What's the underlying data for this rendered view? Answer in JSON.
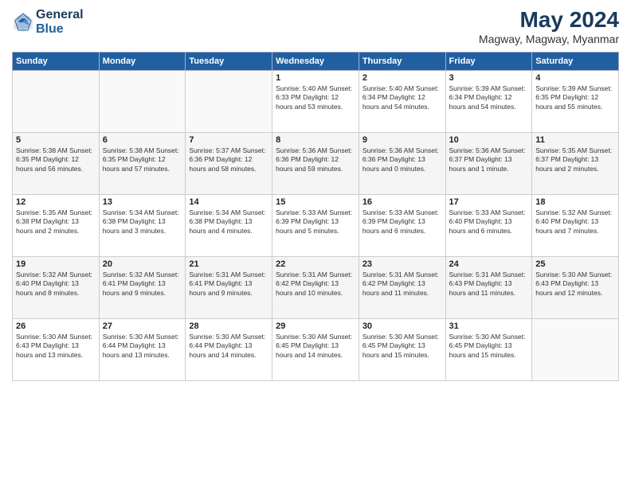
{
  "logo": {
    "line1": "General",
    "line2": "Blue"
  },
  "title": "May 2024",
  "location": "Magway, Magway, Myanmar",
  "days_of_week": [
    "Sunday",
    "Monday",
    "Tuesday",
    "Wednesday",
    "Thursday",
    "Friday",
    "Saturday"
  ],
  "weeks": [
    [
      {
        "day": "",
        "info": ""
      },
      {
        "day": "",
        "info": ""
      },
      {
        "day": "",
        "info": ""
      },
      {
        "day": "1",
        "info": "Sunrise: 5:40 AM\nSunset: 6:33 PM\nDaylight: 12 hours\nand 53 minutes."
      },
      {
        "day": "2",
        "info": "Sunrise: 5:40 AM\nSunset: 6:34 PM\nDaylight: 12 hours\nand 54 minutes."
      },
      {
        "day": "3",
        "info": "Sunrise: 5:39 AM\nSunset: 6:34 PM\nDaylight: 12 hours\nand 54 minutes."
      },
      {
        "day": "4",
        "info": "Sunrise: 5:39 AM\nSunset: 6:35 PM\nDaylight: 12 hours\nand 55 minutes."
      }
    ],
    [
      {
        "day": "5",
        "info": "Sunrise: 5:38 AM\nSunset: 6:35 PM\nDaylight: 12 hours\nand 56 minutes."
      },
      {
        "day": "6",
        "info": "Sunrise: 5:38 AM\nSunset: 6:35 PM\nDaylight: 12 hours\nand 57 minutes."
      },
      {
        "day": "7",
        "info": "Sunrise: 5:37 AM\nSunset: 6:36 PM\nDaylight: 12 hours\nand 58 minutes."
      },
      {
        "day": "8",
        "info": "Sunrise: 5:36 AM\nSunset: 6:36 PM\nDaylight: 12 hours\nand 59 minutes."
      },
      {
        "day": "9",
        "info": "Sunrise: 5:36 AM\nSunset: 6:36 PM\nDaylight: 13 hours\nand 0 minutes."
      },
      {
        "day": "10",
        "info": "Sunrise: 5:36 AM\nSunset: 6:37 PM\nDaylight: 13 hours\nand 1 minute."
      },
      {
        "day": "11",
        "info": "Sunrise: 5:35 AM\nSunset: 6:37 PM\nDaylight: 13 hours\nand 2 minutes."
      }
    ],
    [
      {
        "day": "12",
        "info": "Sunrise: 5:35 AM\nSunset: 6:38 PM\nDaylight: 13 hours\nand 2 minutes."
      },
      {
        "day": "13",
        "info": "Sunrise: 5:34 AM\nSunset: 6:38 PM\nDaylight: 13 hours\nand 3 minutes."
      },
      {
        "day": "14",
        "info": "Sunrise: 5:34 AM\nSunset: 6:38 PM\nDaylight: 13 hours\nand 4 minutes."
      },
      {
        "day": "15",
        "info": "Sunrise: 5:33 AM\nSunset: 6:39 PM\nDaylight: 13 hours\nand 5 minutes."
      },
      {
        "day": "16",
        "info": "Sunrise: 5:33 AM\nSunset: 6:39 PM\nDaylight: 13 hours\nand 6 minutes."
      },
      {
        "day": "17",
        "info": "Sunrise: 5:33 AM\nSunset: 6:40 PM\nDaylight: 13 hours\nand 6 minutes."
      },
      {
        "day": "18",
        "info": "Sunrise: 5:32 AM\nSunset: 6:40 PM\nDaylight: 13 hours\nand 7 minutes."
      }
    ],
    [
      {
        "day": "19",
        "info": "Sunrise: 5:32 AM\nSunset: 6:40 PM\nDaylight: 13 hours\nand 8 minutes."
      },
      {
        "day": "20",
        "info": "Sunrise: 5:32 AM\nSunset: 6:41 PM\nDaylight: 13 hours\nand 9 minutes."
      },
      {
        "day": "21",
        "info": "Sunrise: 5:31 AM\nSunset: 6:41 PM\nDaylight: 13 hours\nand 9 minutes."
      },
      {
        "day": "22",
        "info": "Sunrise: 5:31 AM\nSunset: 6:42 PM\nDaylight: 13 hours\nand 10 minutes."
      },
      {
        "day": "23",
        "info": "Sunrise: 5:31 AM\nSunset: 6:42 PM\nDaylight: 13 hours\nand 11 minutes."
      },
      {
        "day": "24",
        "info": "Sunrise: 5:31 AM\nSunset: 6:43 PM\nDaylight: 13 hours\nand 11 minutes."
      },
      {
        "day": "25",
        "info": "Sunrise: 5:30 AM\nSunset: 6:43 PM\nDaylight: 13 hours\nand 12 minutes."
      }
    ],
    [
      {
        "day": "26",
        "info": "Sunrise: 5:30 AM\nSunset: 6:43 PM\nDaylight: 13 hours\nand 13 minutes."
      },
      {
        "day": "27",
        "info": "Sunrise: 5:30 AM\nSunset: 6:44 PM\nDaylight: 13 hours\nand 13 minutes."
      },
      {
        "day": "28",
        "info": "Sunrise: 5:30 AM\nSunset: 6:44 PM\nDaylight: 13 hours\nand 14 minutes."
      },
      {
        "day": "29",
        "info": "Sunrise: 5:30 AM\nSunset: 6:45 PM\nDaylight: 13 hours\nand 14 minutes."
      },
      {
        "day": "30",
        "info": "Sunrise: 5:30 AM\nSunset: 6:45 PM\nDaylight: 13 hours\nand 15 minutes."
      },
      {
        "day": "31",
        "info": "Sunrise: 5:30 AM\nSunset: 6:45 PM\nDaylight: 13 hours\nand 15 minutes."
      },
      {
        "day": "",
        "info": ""
      }
    ]
  ]
}
